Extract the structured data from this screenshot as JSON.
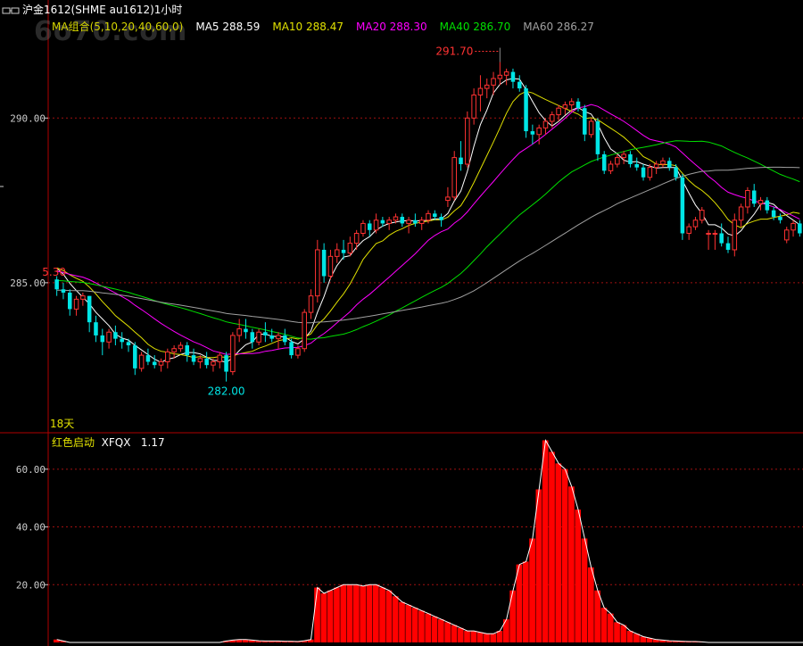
{
  "window": {
    "title": "沪金1612(SHME au1612)1小时",
    "icon": "window-restore-icon"
  },
  "watermark": "6o70.com",
  "ma_legend": {
    "group": {
      "label": "MA组合(5,10,20,40,60,0)",
      "color": "#d4d400"
    },
    "items": [
      {
        "label": "MA5 288.59",
        "color": "#ffffff"
      },
      {
        "label": "MA10 288.47",
        "color": "#e0e000"
      },
      {
        "label": "MA20 288.30",
        "color": "#ff00ff"
      },
      {
        "label": "MA40 286.70",
        "color": "#00e000"
      },
      {
        "label": "MA60 286.27",
        "color": "#a0a0a0"
      }
    ]
  },
  "indicator_legend": {
    "name": "红色启动",
    "name_color": "#e0e000",
    "code": "XFQX",
    "value": "1.17",
    "code_color": "#ffffff"
  },
  "colors": {
    "up": "#ff3232",
    "down": "#00e5e5",
    "axis": "#b00000",
    "grid": "#a01010",
    "text": "#cccccc",
    "bar": "#ff0000"
  },
  "chart_data": [
    {
      "type": "candlestick",
      "yticks": [
        285.0,
        290.0
      ],
      "ytick_labels": [
        "285.00",
        "290.00"
      ],
      "ylim": [
        280.5,
        292.5
      ],
      "annotations": {
        "high": {
          "label": "291.70",
          "value": 291.7,
          "index": 68
        },
        "low": {
          "label": "282.00",
          "value": 282.0,
          "index": 26
        },
        "left_price": {
          "label": "5.30",
          "value": 285.3
        },
        "days_label": "18天"
      },
      "candles": [
        [
          285.1,
          285.2,
          284.6,
          284.8
        ],
        [
          284.8,
          285.0,
          284.5,
          284.7
        ],
        [
          284.7,
          284.8,
          284.0,
          284.2
        ],
        [
          284.2,
          284.6,
          284.0,
          284.5
        ],
        [
          284.5,
          284.7,
          284.3,
          284.6
        ],
        [
          284.6,
          284.6,
          283.5,
          283.8
        ],
        [
          283.8,
          284.0,
          283.2,
          283.4
        ],
        [
          283.4,
          283.6,
          282.8,
          283.2
        ],
        [
          283.2,
          283.6,
          283.0,
          283.5
        ],
        [
          283.5,
          283.7,
          283.1,
          283.3
        ],
        [
          283.3,
          283.5,
          283.0,
          283.2
        ],
        [
          283.2,
          283.3,
          282.9,
          283.1
        ],
        [
          283.1,
          283.2,
          282.2,
          282.4
        ],
        [
          282.4,
          282.9,
          282.3,
          282.8
        ],
        [
          282.8,
          283.0,
          282.5,
          282.6
        ],
        [
          282.6,
          282.8,
          282.4,
          282.5
        ],
        [
          282.5,
          282.7,
          282.3,
          282.6
        ],
        [
          282.6,
          283.0,
          282.4,
          282.9
        ],
        [
          282.9,
          283.1,
          282.7,
          283.0
        ],
        [
          283.0,
          283.2,
          282.9,
          283.1
        ],
        [
          283.1,
          283.2,
          282.6,
          282.8
        ],
        [
          282.8,
          283.0,
          282.5,
          282.6
        ],
        [
          282.6,
          282.8,
          282.4,
          282.7
        ],
        [
          282.7,
          282.9,
          282.4,
          282.5
        ],
        [
          282.5,
          282.7,
          282.3,
          282.6
        ],
        [
          282.6,
          282.9,
          282.4,
          282.8
        ],
        [
          282.8,
          282.9,
          282.0,
          282.3
        ],
        [
          282.3,
          283.5,
          282.2,
          283.4
        ],
        [
          283.4,
          283.9,
          283.2,
          283.6
        ],
        [
          283.6,
          283.9,
          283.3,
          283.5
        ],
        [
          283.5,
          283.6,
          283.0,
          283.2
        ],
        [
          283.2,
          283.6,
          283.1,
          283.5
        ],
        [
          283.5,
          283.8,
          283.2,
          283.4
        ],
        [
          283.4,
          283.6,
          283.2,
          283.3
        ],
        [
          283.3,
          283.5,
          283.0,
          283.4
        ],
        [
          283.4,
          283.6,
          283.1,
          283.2
        ],
        [
          283.2,
          283.3,
          282.7,
          282.8
        ],
        [
          282.8,
          283.1,
          282.7,
          283.0
        ],
        [
          283.0,
          284.2,
          282.9,
          284.1
        ],
        [
          284.1,
          284.8,
          283.9,
          284.6
        ],
        [
          284.6,
          286.3,
          284.4,
          286.0
        ],
        [
          286.0,
          286.2,
          285.0,
          285.2
        ],
        [
          285.2,
          286.0,
          285.1,
          285.8
        ],
        [
          285.8,
          286.2,
          285.6,
          286.0
        ],
        [
          286.0,
          286.3,
          285.7,
          285.9
        ],
        [
          285.9,
          286.4,
          285.8,
          286.2
        ],
        [
          286.2,
          286.6,
          286.0,
          286.5
        ],
        [
          286.5,
          286.9,
          286.4,
          286.8
        ],
        [
          286.8,
          286.9,
          286.4,
          286.6
        ],
        [
          286.6,
          287.1,
          286.5,
          286.9
        ],
        [
          286.9,
          287.0,
          286.7,
          286.8
        ],
        [
          286.8,
          287.0,
          286.6,
          286.9
        ],
        [
          286.9,
          287.1,
          286.8,
          287.0
        ],
        [
          287.0,
          287.1,
          286.7,
          286.8
        ],
        [
          286.8,
          287.0,
          286.5,
          286.9
        ],
        [
          286.9,
          287.1,
          286.7,
          286.8
        ],
        [
          286.8,
          287.0,
          286.6,
          286.9
        ],
        [
          286.9,
          287.2,
          286.8,
          287.1
        ],
        [
          287.1,
          287.2,
          286.9,
          287.0
        ],
        [
          287.0,
          287.1,
          286.7,
          286.9
        ],
        [
          287.5,
          287.9,
          287.3,
          287.6
        ],
        [
          287.6,
          289.0,
          287.5,
          288.8
        ],
        [
          288.8,
          289.3,
          288.4,
          288.6
        ],
        [
          288.6,
          290.2,
          288.5,
          290.0
        ],
        [
          290.0,
          290.9,
          289.8,
          290.7
        ],
        [
          290.7,
          291.3,
          290.2,
          290.9
        ],
        [
          290.9,
          291.2,
          290.6,
          291.0
        ],
        [
          291.0,
          291.4,
          290.7,
          291.2
        ],
        [
          291.2,
          291.7,
          291.0,
          291.3
        ],
        [
          291.3,
          291.5,
          291.0,
          291.4
        ],
        [
          291.4,
          291.5,
          290.9,
          291.1
        ],
        [
          291.1,
          291.3,
          290.8,
          290.9
        ],
        [
          290.9,
          291.0,
          289.4,
          289.6
        ],
        [
          289.6,
          289.8,
          289.2,
          289.5
        ],
        [
          289.5,
          289.8,
          289.2,
          289.7
        ],
        [
          289.7,
          290.0,
          289.5,
          289.9
        ],
        [
          289.9,
          290.2,
          289.7,
          290.1
        ],
        [
          290.1,
          290.4,
          289.9,
          290.3
        ],
        [
          290.3,
          290.5,
          290.1,
          290.4
        ],
        [
          290.4,
          290.6,
          290.2,
          290.5
        ],
        [
          290.5,
          290.6,
          290.2,
          290.3
        ],
        [
          290.3,
          290.4,
          289.3,
          289.5
        ],
        [
          289.5,
          290.0,
          289.4,
          289.9
        ],
        [
          289.9,
          290.0,
          288.7,
          288.9
        ],
        [
          288.9,
          289.0,
          288.3,
          288.4
        ],
        [
          288.4,
          288.7,
          288.3,
          288.6
        ],
        [
          288.6,
          288.9,
          288.5,
          288.8
        ],
        [
          288.8,
          289.0,
          288.6,
          288.9
        ],
        [
          288.9,
          289.0,
          288.5,
          288.6
        ],
        [
          288.6,
          288.8,
          288.4,
          288.5
        ],
        [
          288.5,
          288.6,
          288.1,
          288.2
        ],
        [
          288.2,
          288.6,
          288.1,
          288.5
        ],
        [
          288.5,
          288.7,
          288.3,
          288.6
        ],
        [
          288.6,
          288.8,
          288.5,
          288.7
        ],
        [
          288.7,
          288.8,
          288.4,
          288.5
        ],
        [
          288.5,
          288.6,
          288.1,
          288.2
        ],
        [
          288.2,
          288.3,
          286.3,
          286.5
        ],
        [
          286.5,
          286.8,
          286.3,
          286.7
        ],
        [
          286.7,
          287.0,
          286.6,
          286.9
        ],
        [
          286.9,
          287.3,
          286.8,
          287.2
        ],
        [
          286.5,
          286.6,
          286.0,
          286.5
        ],
        [
          286.5,
          286.6,
          286.0,
          286.5
        ],
        [
          286.5,
          286.8,
          286.1,
          286.2
        ],
        [
          286.2,
          286.4,
          285.9,
          286.0
        ],
        [
          286.0,
          287.1,
          285.8,
          286.9
        ],
        [
          286.9,
          287.4,
          286.7,
          287.3
        ],
        [
          287.3,
          287.9,
          287.1,
          287.8
        ],
        [
          287.8,
          288.0,
          287.3,
          287.4
        ],
        [
          287.4,
          287.6,
          287.2,
          287.5
        ],
        [
          287.5,
          287.6,
          287.1,
          287.2
        ],
        [
          287.2,
          287.3,
          286.9,
          287.0
        ],
        [
          287.0,
          287.1,
          286.8,
          286.9
        ],
        [
          286.3,
          286.7,
          286.2,
          286.6
        ],
        [
          286.6,
          286.9,
          286.4,
          286.8
        ],
        [
          286.8,
          286.9,
          286.4,
          286.5
        ]
      ],
      "moving_averages": [
        {
          "period": 5,
          "color": "#ffffff"
        },
        {
          "period": 10,
          "color": "#e0e000"
        },
        {
          "period": 20,
          "color": "#ff00ff"
        },
        {
          "period": 40,
          "color": "#00e000"
        },
        {
          "period": 60,
          "color": "#a0a0a0"
        }
      ]
    },
    {
      "type": "bar",
      "name": "XFQX",
      "yticks": [
        20,
        40,
        60
      ],
      "ytick_labels": [
        "20.00",
        "40.00",
        "60.00"
      ],
      "ylim": [
        0,
        72
      ],
      "values": [
        1,
        0.5,
        0,
        0,
        0,
        0,
        0,
        0,
        0,
        0,
        0,
        0,
        0,
        0,
        0,
        0,
        0,
        0,
        0,
        0,
        0,
        0,
        0,
        0,
        0,
        0,
        0.5,
        0.8,
        1,
        1,
        0.8,
        0.6,
        0.5,
        0.5,
        0.5,
        0.4,
        0.4,
        0.3,
        0.6,
        1,
        19,
        17,
        18,
        19,
        20,
        20,
        20,
        19.5,
        20,
        20,
        19,
        18,
        16,
        14,
        13,
        12,
        11,
        10,
        9,
        8,
        7,
        6,
        5,
        4,
        4,
        3.5,
        3,
        3,
        4,
        8,
        18,
        27,
        28,
        36,
        53,
        70,
        66,
        62,
        60,
        54,
        46,
        36,
        26,
        18,
        12,
        10,
        7,
        6,
        4,
        3,
        2,
        1.5,
        1,
        0.8,
        0.6,
        0.5,
        0.4,
        0.3,
        0.3,
        0.2,
        0,
        0,
        0,
        0,
        0,
        0,
        0,
        0,
        0,
        0,
        0,
        0,
        0,
        0,
        0,
        0,
        0,
        0,
        0,
        0,
        0,
        0,
        0,
        0,
        0,
        0,
        0,
        0,
        0,
        0
      ]
    }
  ]
}
